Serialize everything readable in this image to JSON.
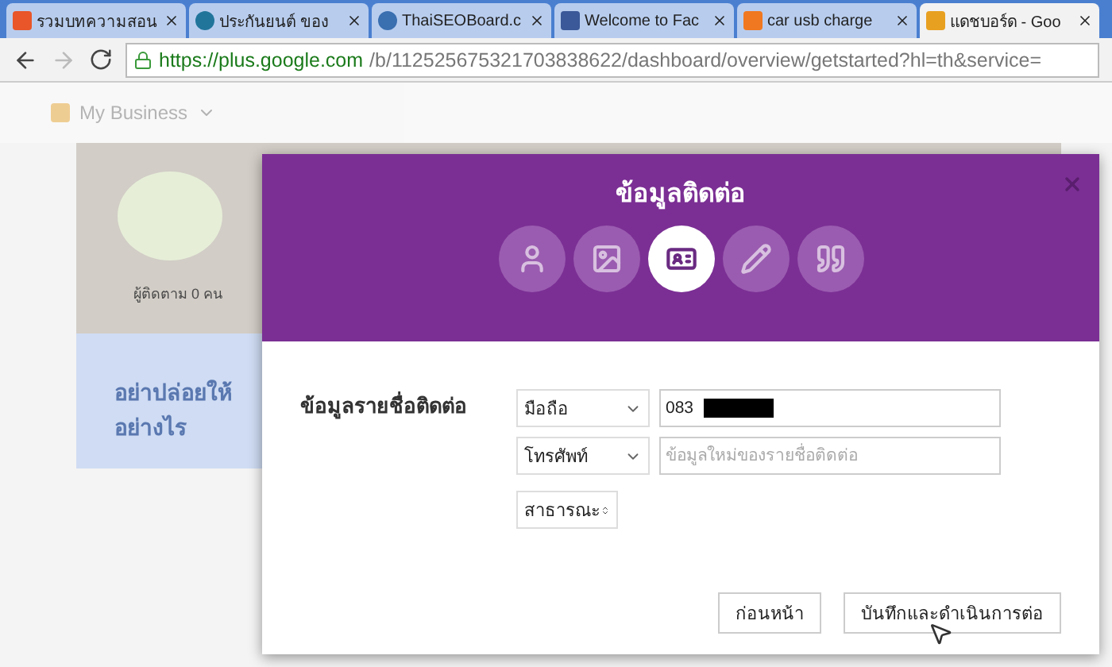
{
  "browser": {
    "tabs": [
      {
        "title": "รวมบทความสอน",
        "selected": false
      },
      {
        "title": "ประกันยนต์ ของ",
        "selected": false
      },
      {
        "title": "ThaiSEOBoard.c",
        "selected": false
      },
      {
        "title": "Welcome to Fac",
        "selected": false
      },
      {
        "title": "car usb charge",
        "selected": false
      },
      {
        "title": "แดชบอร์ด - Goo",
        "selected": true
      }
    ],
    "url_host": "https://plus.google.com",
    "url_path": "/b/112525675321703838622/dashboard/overview/getstarted?hl=th&service="
  },
  "page": {
    "product": "My Business",
    "followers": "ผู้ติดตาม 0 คน",
    "promo": "อย่าปล่อยให้",
    "promo_2": "อย่างไร"
  },
  "dialog": {
    "title": "ข้อมูลติดต่อ",
    "steps": [
      {
        "kind": "person",
        "selected": false
      },
      {
        "kind": "image",
        "selected": false
      },
      {
        "kind": "card",
        "selected": true
      },
      {
        "kind": "pencil",
        "selected": false
      },
      {
        "kind": "quote",
        "selected": false
      }
    ],
    "section_label": "ข้อมูลรายชื่อติดต่อ",
    "rows": [
      {
        "type": "มือถือ",
        "value": "083",
        "redacted": true
      },
      {
        "type": "โทรศัพท์",
        "placeholder": "ข้อมูลใหม่ของรายชื่อติดต่อ",
        "redacted": false
      }
    ],
    "visibility": "สาธารณะ",
    "buttons": [
      "ก่อนหน้า",
      "บันทึกและดำเนินการต่อ"
    ]
  }
}
